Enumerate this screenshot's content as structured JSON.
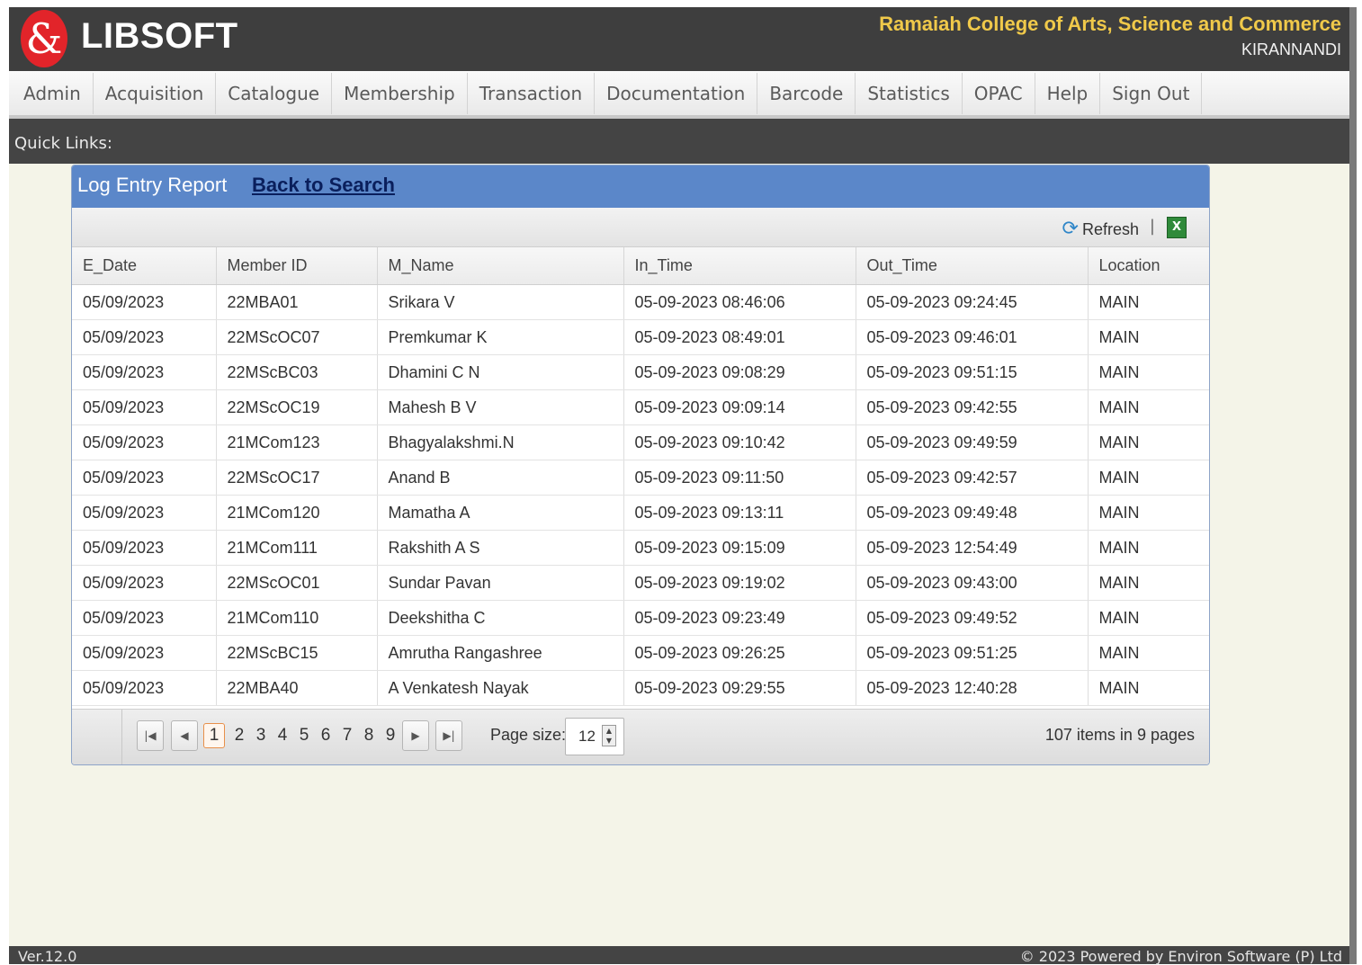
{
  "header": {
    "logo_letter": "&",
    "logo_text": "LIBSOFT",
    "college": "Ramaiah College of Arts, Science and Commerce",
    "user": "KIRANNANDI"
  },
  "menu": [
    "Admin",
    "Acquisition",
    "Catalogue",
    "Membership",
    "Transaction",
    "Documentation",
    "Barcode",
    "Statistics",
    "OPAC",
    "Help",
    "Sign Out"
  ],
  "quick_links_label": "Quick Links:",
  "panel": {
    "title": "Log Entry Report",
    "back_link": "Back to Search",
    "refresh_label": "Refresh",
    "separator": "|",
    "excel_icon": "excel-export-icon"
  },
  "table": {
    "columns": [
      "E_Date",
      "Member ID",
      "M_Name",
      "In_Time",
      "Out_Time",
      "Location"
    ],
    "rows": [
      [
        "05/09/2023",
        "22MBA01",
        "Srikara V",
        "05-09-2023 08:46:06",
        "05-09-2023 09:24:45",
        "MAIN"
      ],
      [
        "05/09/2023",
        "22MScOC07",
        "Premkumar K",
        "05-09-2023 08:49:01",
        "05-09-2023 09:46:01",
        "MAIN"
      ],
      [
        "05/09/2023",
        "22MScBC03",
        "Dhamini C N",
        "05-09-2023 09:08:29",
        "05-09-2023 09:51:15",
        "MAIN"
      ],
      [
        "05/09/2023",
        "22MScOC19",
        "Mahesh B V",
        "05-09-2023 09:09:14",
        "05-09-2023 09:42:55",
        "MAIN"
      ],
      [
        "05/09/2023",
        "21MCom123",
        "Bhagyalakshmi.N",
        "05-09-2023 09:10:42",
        "05-09-2023 09:49:59",
        "MAIN"
      ],
      [
        "05/09/2023",
        "22MScOC17",
        "Anand B",
        "05-09-2023 09:11:50",
        "05-09-2023 09:42:57",
        "MAIN"
      ],
      [
        "05/09/2023",
        "21MCom120",
        "Mamatha A",
        "05-09-2023 09:13:11",
        "05-09-2023 09:49:48",
        "MAIN"
      ],
      [
        "05/09/2023",
        "21MCom111",
        "Rakshith A S",
        "05-09-2023 09:15:09",
        "05-09-2023 12:54:49",
        "MAIN"
      ],
      [
        "05/09/2023",
        "22MScOC01",
        "Sundar Pavan",
        "05-09-2023 09:19:02",
        "05-09-2023 09:43:00",
        "MAIN"
      ],
      [
        "05/09/2023",
        "21MCom110",
        "Deekshitha C",
        "05-09-2023 09:23:49",
        "05-09-2023 09:49:52",
        "MAIN"
      ],
      [
        "05/09/2023",
        "22MScBC15",
        "Amrutha Rangashree",
        "05-09-2023 09:26:25",
        "05-09-2023 09:51:25",
        "MAIN"
      ],
      [
        "05/09/2023",
        "22MBA40",
        "A Venkatesh Nayak",
        "05-09-2023 09:29:55",
        "05-09-2023 12:40:28",
        "MAIN"
      ]
    ]
  },
  "pager": {
    "pages": [
      "1",
      "2",
      "3",
      "4",
      "5",
      "6",
      "7",
      "8",
      "9"
    ],
    "current_page": "1",
    "page_size_label": "Page size:",
    "page_size_value": "12",
    "summary": "107 items in 9 pages"
  },
  "footer": {
    "version": "Ver.12.0",
    "powered": "© 2023  Powered by Environ Software (P) Ltd"
  }
}
